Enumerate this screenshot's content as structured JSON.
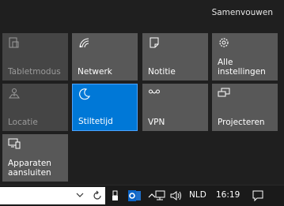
{
  "collapse_label": "Samenvouwen",
  "tiles": {
    "tabletmodus": {
      "label": "Tabletmodus",
      "icon": "tablet-mode-icon",
      "state": "off"
    },
    "netwerk": {
      "label": "Netwerk",
      "icon": "network-icon",
      "state": "on"
    },
    "notitie": {
      "label": "Notitie",
      "icon": "note-icon",
      "state": "on"
    },
    "alle_instellingen": {
      "label": "Alle\ninstellingen",
      "icon": "gear-icon",
      "state": "on"
    },
    "locatie": {
      "label": "Locatie",
      "icon": "location-icon",
      "state": "off"
    },
    "stiltetijd": {
      "label": "Stiltetijd",
      "icon": "moon-icon",
      "state": "active"
    },
    "vpn": {
      "label": "VPN",
      "icon": "vpn-icon",
      "state": "on"
    },
    "projecteren": {
      "label": "Projecteren",
      "icon": "project-icon",
      "state": "on"
    },
    "apparaten": {
      "label": "Apparaten\naansluiten",
      "icon": "connect-devices-icon",
      "state": "on"
    }
  },
  "taskbar": {
    "language": "NLD",
    "time": "16:19"
  },
  "colors": {
    "background": "#1f1f1f",
    "tile": "#585858",
    "tile_off": "#454545",
    "accent": "#0078d7"
  }
}
